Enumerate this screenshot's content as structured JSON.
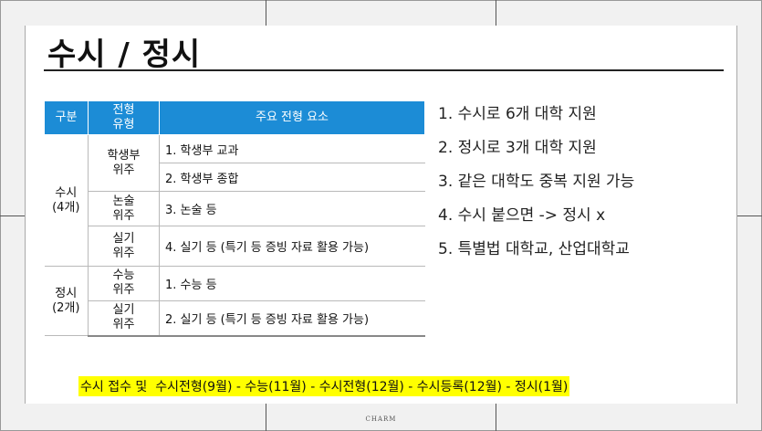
{
  "slide": {
    "title": "수시 / 정시",
    "footer": "CHARM"
  },
  "table": {
    "headers": [
      "구분",
      "전형\n유형",
      "주요 전형 요소"
    ],
    "groups": [
      {
        "label": "수시\n(4개)",
        "rows": [
          {
            "type": "학생부\n위주",
            "items": [
              "1. 학생부 교과",
              "2. 학생부 종합"
            ]
          },
          {
            "type": "논술\n위주",
            "items": [
              "3. 논술 등"
            ]
          },
          {
            "type": "실기\n위주",
            "items": [
              "4. 실기 등 (특기 등 증빙 자료 활용 가능)"
            ]
          }
        ]
      },
      {
        "label": "정시\n(2개)",
        "rows": [
          {
            "type": "수능\n위주",
            "items": [
              "1. 수능 등"
            ]
          },
          {
            "type": "실기\n위주",
            "items": [
              "2. 실기 등 (특기 등 증빙 자료 활용 가능)"
            ]
          }
        ]
      }
    ]
  },
  "notes": [
    "1. 수시로 6개 대학 지원",
    "2. 정시로 3개 대학 지원",
    "3. 같은 대학도 중복 지원 가능",
    "4. 수시 붙으면 -> 정시 x",
    "5. 특별법 대학교, 산업대학교"
  ],
  "banner": "수시 접수 및  수시전형(9월) - 수능(11월) - 수시전형(12월) - 수시등록(12월) - 정시(1월)",
  "colors": {
    "header_bg": "#1c8cd6",
    "highlight": "#ffff00"
  }
}
